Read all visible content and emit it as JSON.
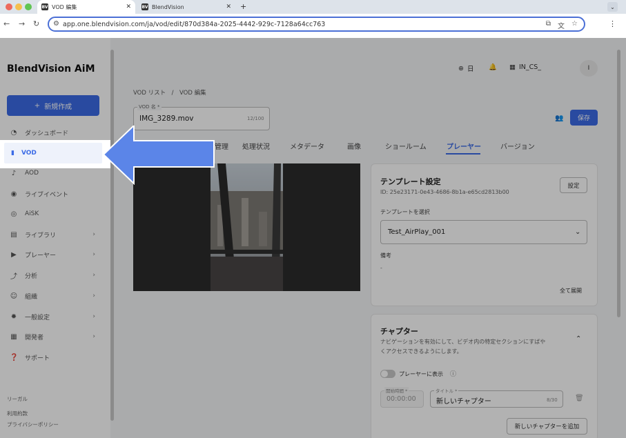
{
  "browser": {
    "tabs": [
      {
        "label": "VOD 編集",
        "favicon": "BV"
      },
      {
        "label": "BlendVision",
        "favicon": "BV"
      }
    ],
    "url": "app.one.blendvision.com/ja/vod/edit/870d384a-2025-4442-929c-7128a64cc763"
  },
  "sidebar": {
    "brand": "BlendVision AiM",
    "new_button": "新規作成",
    "items": [
      {
        "label": "ダッシュボード",
        "icon": "dashboard-icon"
      },
      {
        "label": "VOD",
        "icon": "vod-icon"
      },
      {
        "label": "AOD",
        "icon": "music-note-icon"
      },
      {
        "label": "ライブイベント",
        "icon": "live-icon"
      },
      {
        "label": "AiSK",
        "icon": "ai-icon"
      },
      {
        "label": "ライブラリ",
        "icon": "library-icon"
      },
      {
        "label": "プレーヤー",
        "icon": "player-icon"
      },
      {
        "label": "分析",
        "icon": "chart-icon"
      },
      {
        "label": "組織",
        "icon": "people-icon"
      },
      {
        "label": "一般設定",
        "icon": "gear-icon"
      },
      {
        "label": "開発者",
        "icon": "grid-icon"
      },
      {
        "label": "サポート",
        "icon": "support-icon"
      }
    ],
    "footer": [
      "リーガル",
      "利用約款",
      "プライバシーポリシー"
    ]
  },
  "header": {
    "language": "日",
    "org": "IN_CS_",
    "avatar": "I"
  },
  "page": {
    "breadcrumb": "VOD リスト　/　VOD 編集",
    "name_label": "VOD 名 *",
    "name_value": "IMG_3289.mov",
    "name_count": "12/100",
    "save": "保存",
    "tabs": [
      "管理",
      "処理状況",
      "メタデータ",
      "画像",
      "ショールーム",
      "プレーヤー",
      "バージョン"
    ]
  },
  "template": {
    "title": "テンプレート設定",
    "id": "ID: 25e23171-0e43-4686-8b1a-e65cd2813b00",
    "settings_button": "設定",
    "select_label": "テンプレートを選択",
    "select_value": "Test_AirPlay_001",
    "note_label": "備考",
    "note_value": "-",
    "expand_all": "全て展開"
  },
  "chapter": {
    "title": "チャプター",
    "description_1": "ナビゲーションを有効にして、ビデオ内の特定セクションにすばや",
    "description_2": "くアクセスできるようにします。",
    "toggle_label": "プレーヤーに表示",
    "start_label": "開始時間 *",
    "start_value": "00:00:00",
    "title_label": "タイトル *",
    "title_value": "新しいチャプター",
    "title_count": "8/30",
    "add_button": "新しいチャプターを追加"
  },
  "colors": {
    "accent": "#3b6be6",
    "arrow": "#5b85e8"
  }
}
